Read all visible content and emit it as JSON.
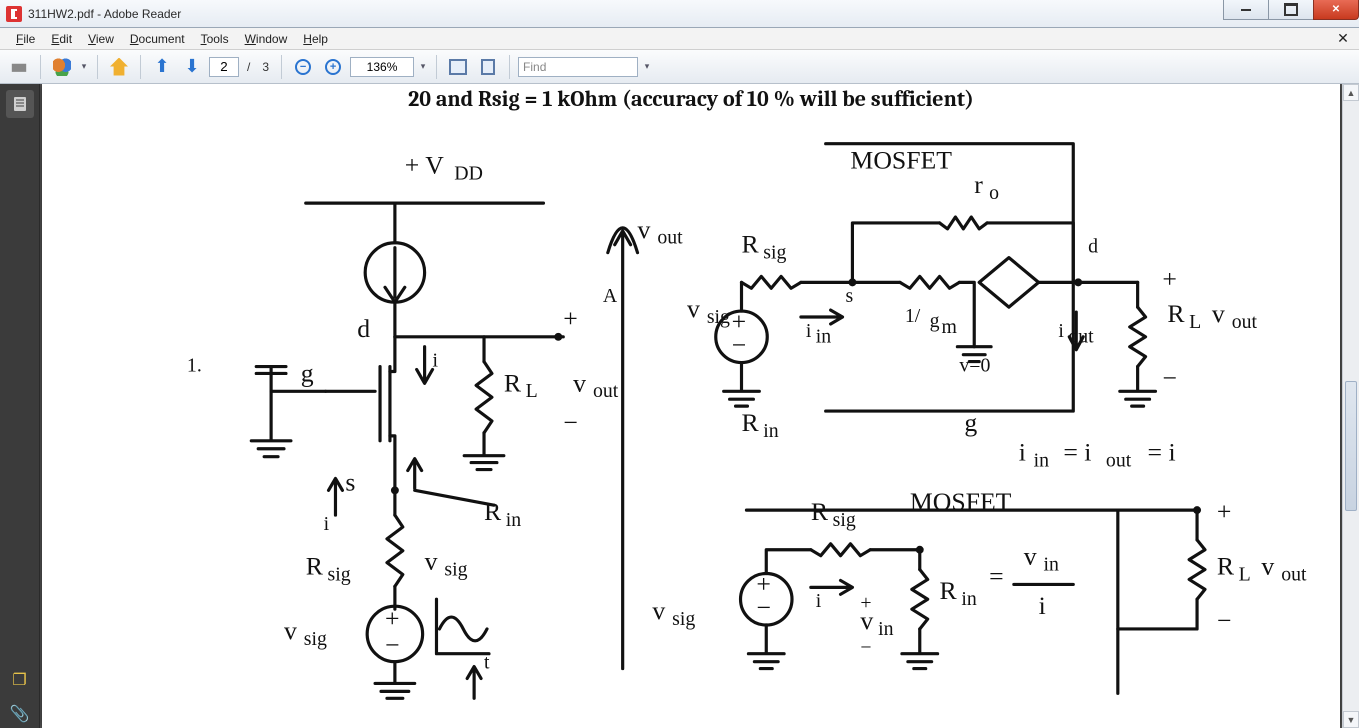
{
  "window": {
    "title": "311HW2.pdf - Adobe Reader"
  },
  "menu": {
    "file": "File",
    "edit": "Edit",
    "view": "View",
    "document": "Document",
    "tools": "Tools",
    "window": "Window",
    "help": "Help"
  },
  "toolbar": {
    "page_current": "2",
    "page_sep": "/",
    "page_total": "3",
    "zoom_value": "136%",
    "find_placeholder": "Find"
  },
  "page": {
    "header_text": "20 and Rsig = 1 kOhm (accuracy of 10 % will be sufficient)"
  }
}
